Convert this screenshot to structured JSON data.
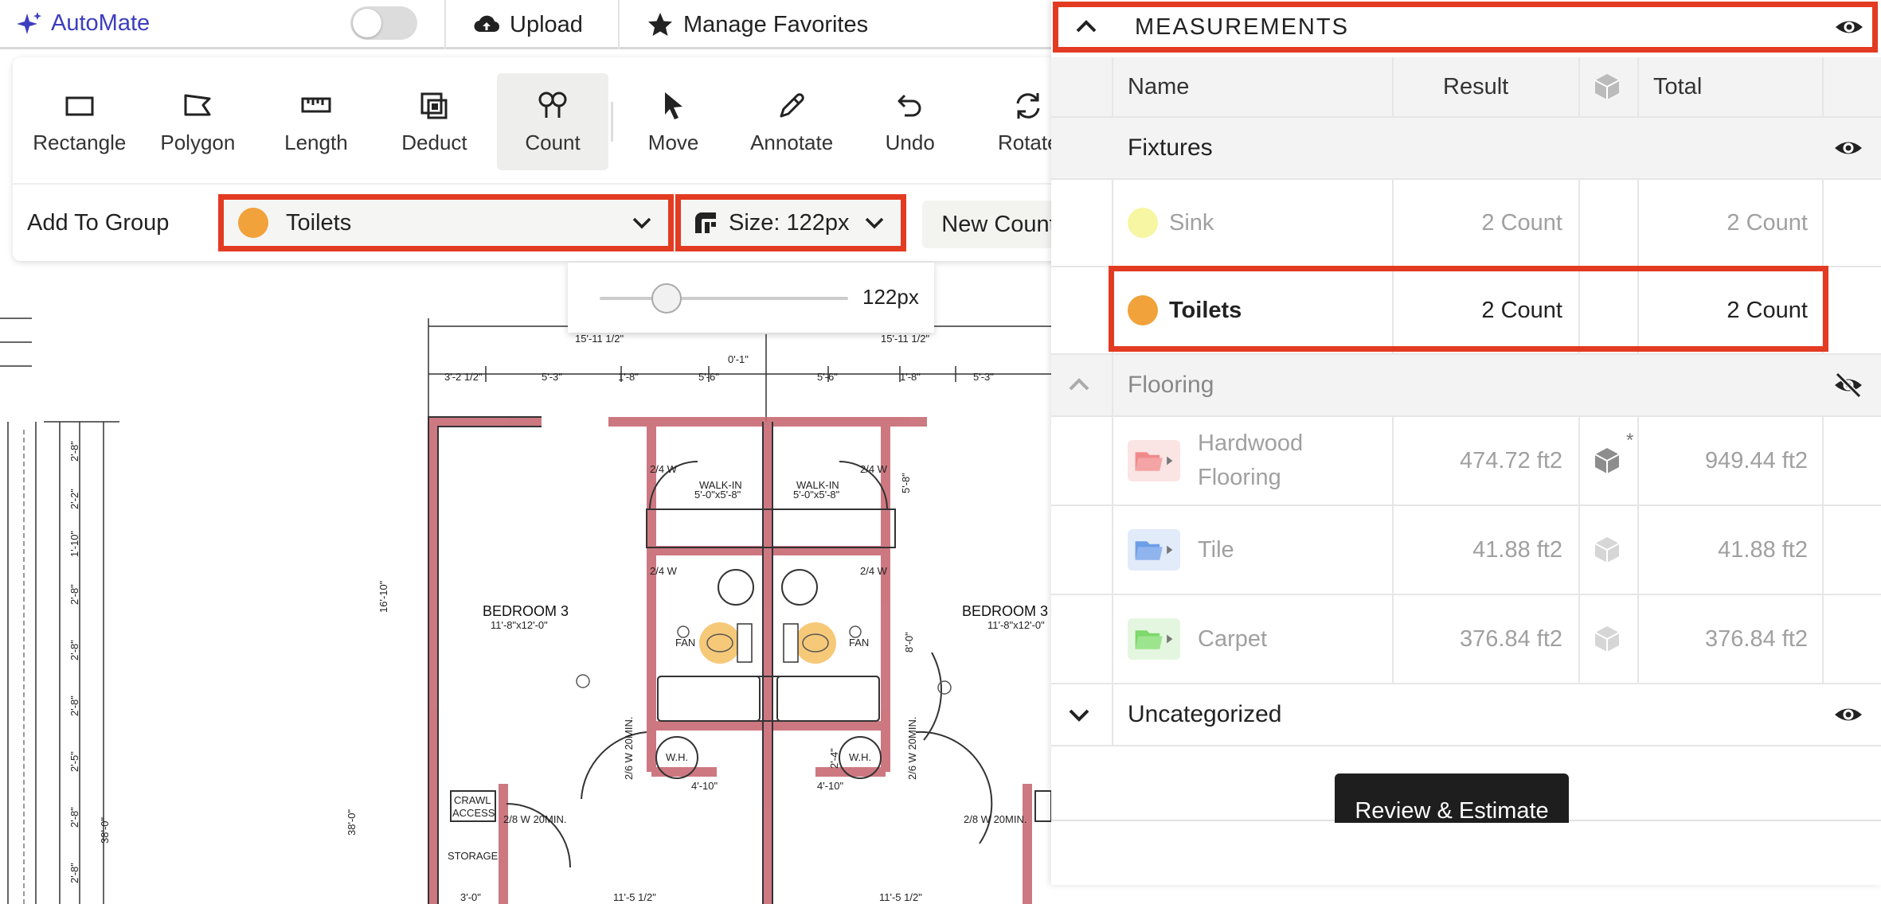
{
  "app": {
    "name": "AutoMate"
  },
  "topbar": {
    "upload_label": "Upload",
    "favorites_label": "Manage Favorites"
  },
  "toolbar": {
    "tools": [
      {
        "label": "Rectangle",
        "icon": "rectangle-icon"
      },
      {
        "label": "Polygon",
        "icon": "polygon-icon"
      },
      {
        "label": "Length",
        "icon": "ruler-icon"
      },
      {
        "label": "Deduct",
        "icon": "deduct-icon"
      },
      {
        "label": "Count",
        "icon": "count-pin-icon",
        "active": true
      },
      {
        "label": "Move",
        "icon": "cursor-icon"
      },
      {
        "label": "Annotate",
        "icon": "pen-icon"
      },
      {
        "label": "Undo",
        "icon": "undo-icon"
      },
      {
        "label": "Rotate",
        "icon": "rotate-icon"
      }
    ],
    "group_label": "Add To Group",
    "group_selected": "Toilets",
    "size_label": "Size: 122px",
    "new_count_label": "New Count",
    "slider_value_label": "122px"
  },
  "measurements": {
    "title": "MEASUREMENTS",
    "columns": {
      "name": "Name",
      "result": "Result",
      "total": "Total"
    },
    "groups": [
      {
        "name": "Fixtures",
        "items": [
          {
            "name": "Sink",
            "result": "2 Count",
            "total": "2 Count",
            "color": "#f6f6a3"
          },
          {
            "name": "Toilets",
            "result": "2 Count",
            "total": "2 Count",
            "color": "#f1a23a"
          }
        ]
      },
      {
        "name": "Flooring",
        "items": [
          {
            "name_line1": "Hardwood",
            "name_line2": "Flooring",
            "result": "474.72 ft2",
            "total": "949.44 ft2",
            "color": "#f08a8a",
            "multiplier_mark": "*"
          },
          {
            "name": "Tile",
            "result": "41.88 ft2",
            "total": "41.88 ft2",
            "color": "#6d9ee8"
          },
          {
            "name": "Carpet",
            "result": "376.84 ft2",
            "total": "376.84 ft2",
            "color": "#7ed86b"
          }
        ]
      },
      {
        "name": "Uncategorized",
        "items": []
      }
    ],
    "review_button": "Review & Estimate"
  },
  "plan": {
    "room_labels": [
      "BEDROOM 3",
      "BEDROOM 3"
    ],
    "room_dims": [
      "11'-8\"x12'-0\"",
      "11'-8\"x12'-0\""
    ],
    "closet_labels": [
      "WALK-IN",
      "WALK-IN"
    ],
    "closet_dims": [
      "5'-0\"x5'-8\"",
      "5'-0\"x5'-8\""
    ],
    "top_dims": [
      "15'-11 1/2\"",
      "15'-11 1/2\""
    ],
    "sub_dims": [
      "3'-2 1/2\"",
      "5'-3\"",
      "1'-8\"",
      "5'-6\"",
      "0'-1\"",
      "5'-6\"",
      "1'-8\"",
      "5'-3\""
    ],
    "left_dims": [
      "2'-8\"",
      "2'-2\"",
      "1'-10\"",
      "2'-8\"",
      "2'-8\"",
      "2'-8\"",
      "2'-5\"",
      "2'-8\"",
      "2'-8\""
    ],
    "misc": [
      "2/4 W",
      "2/4 W",
      "2/4 W",
      "2/4 W",
      "FAN",
      "FAN",
      "W.H.",
      "W.H.",
      "CRAWL",
      "ACCESS",
      "2/8 W 20MIN.",
      "2/8 W 20MIN.",
      "2/6 W 20MIN.",
      "2/6 W 20MIN.",
      "STORAGE",
      "4'-10\"",
      "4'-10\"",
      "16'-10\"",
      "38'-0\"",
      "38'-0\"",
      "8'-0\"",
      "5'-8\"",
      "3'-0\"",
      "11'-5 1/2\"",
      "11'-5 1/2\"",
      "2'-4\""
    ]
  }
}
